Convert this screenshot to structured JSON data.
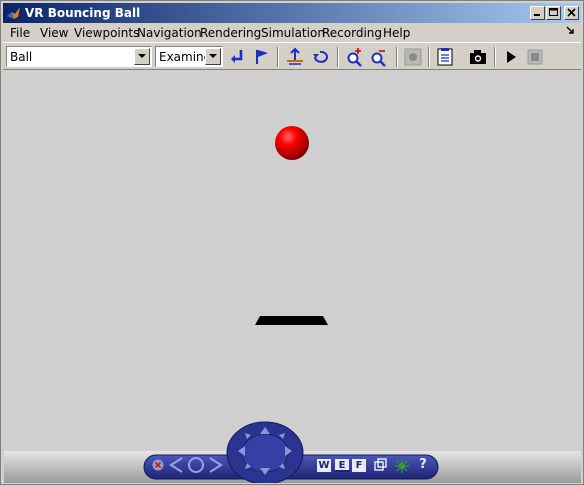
{
  "window": {
    "title": "VR Bouncing Ball"
  },
  "menu": {
    "items": [
      "File",
      "View",
      "Viewpoints",
      "Navigation",
      "Rendering",
      "Simulation",
      "Recording",
      "Help"
    ]
  },
  "toolbar": {
    "viewpoint_select": {
      "value": "Ball"
    },
    "nav_mode_select": {
      "value": "Examine"
    }
  },
  "navpanel": {
    "wireframe_btn": "W",
    "edges_btn": "E",
    "faces_btn": "F",
    "help_btn": "?"
  },
  "colors": {
    "titlebar_start": "#0a246a",
    "titlebar_end": "#a6caf0",
    "ball": "#e00000",
    "platform": "#000000",
    "scene_background": "#cfcfcf",
    "navpanel": "#2b3591"
  }
}
